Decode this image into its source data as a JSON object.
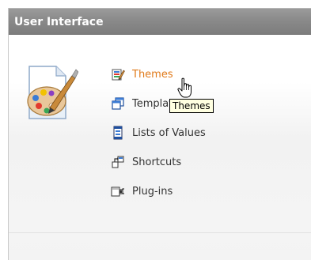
{
  "panel": {
    "title": "User Interface",
    "big_icon": "palette-brush-document-icon"
  },
  "items": [
    {
      "label": "Themes",
      "icon": "themes-icon",
      "state": "hover"
    },
    {
      "label": "Templates",
      "icon": "templates-icon",
      "state": "normal"
    },
    {
      "label": "Lists of Values",
      "icon": "lists-of-values-icon",
      "state": "normal"
    },
    {
      "label": "Shortcuts",
      "icon": "shortcuts-icon",
      "state": "normal"
    },
    {
      "label": "Plug-ins",
      "icon": "plug-ins-icon",
      "state": "normal"
    }
  ],
  "tooltip": {
    "text": "Themes"
  },
  "colors": {
    "header": "#8a8a8a",
    "link_hover": "#e07a1a",
    "link": "#333333",
    "tooltip_bg": "#ffffe1"
  },
  "cursor": "hand-pointer-cursor"
}
